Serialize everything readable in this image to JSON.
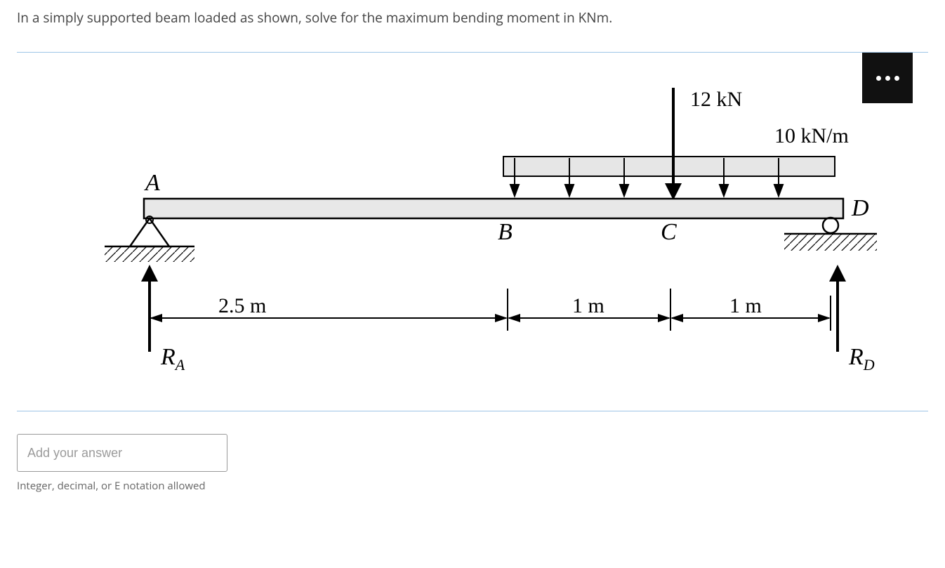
{
  "question": {
    "text": "In a simply supported beam loaded as shown, solve for the maximum bending moment in KNm."
  },
  "figure": {
    "point_load": "12 kN",
    "dist_load": "10 kN/m",
    "label_A": "A",
    "label_B": "B",
    "label_C": "C",
    "label_D": "D",
    "dim_AB": "2.5 m",
    "dim_BC": "1 m",
    "dim_CD": "1 m",
    "reaction_A": "R",
    "reaction_A_sub": "A",
    "reaction_D": "R",
    "reaction_D_sub": "D"
  },
  "answer": {
    "placeholder": "Add your answer",
    "hint": "Integer, decimal, or E notation allowed"
  },
  "icons": {
    "more": "more-options"
  }
}
